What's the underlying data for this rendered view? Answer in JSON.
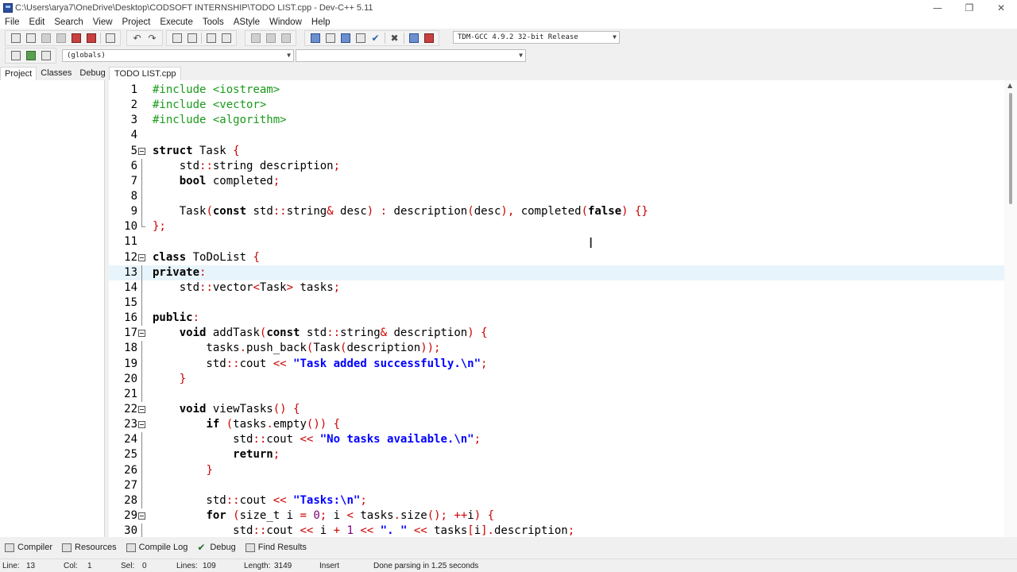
{
  "window": {
    "title": "C:\\Users\\arya7\\OneDrive\\Desktop\\CODSOFT INTERNSHIP\\TODO LIST.cpp - Dev-C++ 5.11",
    "minimize": "—",
    "restore": "❐",
    "close": "✕"
  },
  "menu": [
    "File",
    "Edit",
    "Search",
    "View",
    "Project",
    "Execute",
    "Tools",
    "AStyle",
    "Window",
    "Help"
  ],
  "toolbar": {
    "compiler_select": "TDM-GCC 4.9.2 32-bit Release",
    "scope_select": "(globals)",
    "member_select": ""
  },
  "left_tabs": [
    "Project",
    "Classes",
    "Debug"
  ],
  "editor": {
    "tab_label": "TODO LIST.cpp",
    "current_line": 13
  },
  "code_lines": [
    "1",
    "2",
    "3",
    "4",
    "5",
    "6",
    "7",
    "8",
    "9",
    "10",
    "11",
    "12",
    "13",
    "14",
    "15",
    "16",
    "17",
    "18",
    "19",
    "20",
    "21",
    "22",
    "23",
    "24",
    "25",
    "26",
    "27",
    "28",
    "29",
    "30"
  ],
  "bottom_tabs": [
    "Compiler",
    "Resources",
    "Compile Log",
    "Debug",
    "Find Results"
  ],
  "status": {
    "line_label": "Line:",
    "line_value": "13",
    "col_label": "Col:",
    "col_value": "1",
    "sel_label": "Sel:",
    "sel_value": "0",
    "lines_label": "Lines:",
    "lines_value": "109",
    "length_label": "Length:",
    "length_value": "3149",
    "mode": "Insert",
    "message": "Done parsing in 1.25 seconds"
  }
}
